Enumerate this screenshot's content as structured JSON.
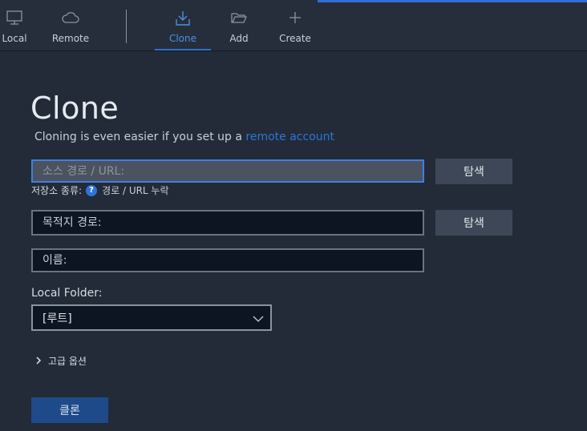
{
  "toolbar": {
    "items": [
      {
        "label": "Local",
        "icon": "monitor-icon"
      },
      {
        "label": "Remote",
        "icon": "cloud-icon"
      },
      {
        "label": "Clone",
        "icon": "download-icon",
        "active": true
      },
      {
        "label": "Add",
        "icon": "folder-open-icon"
      },
      {
        "label": "Create",
        "icon": "plus-icon"
      }
    ]
  },
  "page": {
    "title": "Clone",
    "subtitle_text": "Cloning is even easier if you set up a",
    "subtitle_link": "remote account"
  },
  "form": {
    "source_placeholder": "소스 경로 / URL:",
    "browse_label": "탐색",
    "repo_type_label": "저장소 종류:",
    "repo_type_help": "?",
    "repo_type_value": "경로 / URL 누락",
    "dest_placeholder": "목적지 경로:",
    "name_placeholder": "이름:",
    "local_folder_label": "Local Folder:",
    "local_folder_value": "[루트]",
    "advanced_label": "고급 옵션",
    "clone_button": "클론"
  },
  "colors": {
    "background": "#232b38",
    "toolbar": "#262e3b",
    "accent": "#2f6fd6",
    "link": "#2f73d9",
    "primary_button": "#1e4a8a"
  }
}
